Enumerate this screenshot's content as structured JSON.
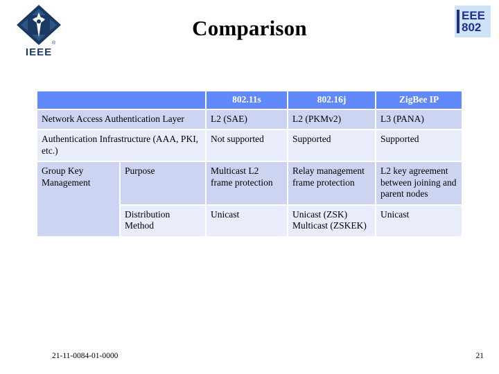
{
  "slide": {
    "title": "Comparison"
  },
  "logo": {
    "ieee_mark_name": "ieee-diamond-logo",
    "ieee_wordmark": "IEEE",
    "registered_mark": "®"
  },
  "badge": {
    "line1": "EEE",
    "line2": "802",
    "bg_color": "#cfe3f7",
    "text_color": "#1f2f8f"
  },
  "table": {
    "header": {
      "blank": "",
      "columns": [
        "802.11s",
        "802.16j",
        "ZigBee IP"
      ]
    },
    "header_bg": "#6189fa",
    "header_text_color": "#ffffff",
    "row_dark_bg": "#ccd4f2",
    "row_light_bg": "#e9ecfa",
    "rows": [
      {
        "label": "Network Access Authentication Layer",
        "sublabel": "",
        "cells": [
          "L2 (SAE)",
          "L2 (PKMv2)",
          "L3 (PANA)"
        ],
        "shade": "dark"
      },
      {
        "label": "Authentication Infrastructure (AAA, PKI, etc.)",
        "sublabel": "",
        "cells": [
          "Not supported",
          "Supported",
          "Supported"
        ],
        "shade": "light"
      },
      {
        "label": "Group Key Management",
        "sublabel": "Purpose",
        "cells": [
          "Multicast L2 frame protection",
          "Relay management frame protection",
          "L2 key agreement between joining and parent nodes"
        ],
        "shade": "dark"
      },
      {
        "label": "",
        "sublabel": "Distribution Method",
        "cells": [
          "Unicast",
          "Unicast (ZSK) Multicast (ZSKEK)",
          "Unicast"
        ],
        "shade": "light"
      }
    ]
  },
  "footer": {
    "document_number": "21-11-0084-01-0000",
    "page_number": "21"
  }
}
